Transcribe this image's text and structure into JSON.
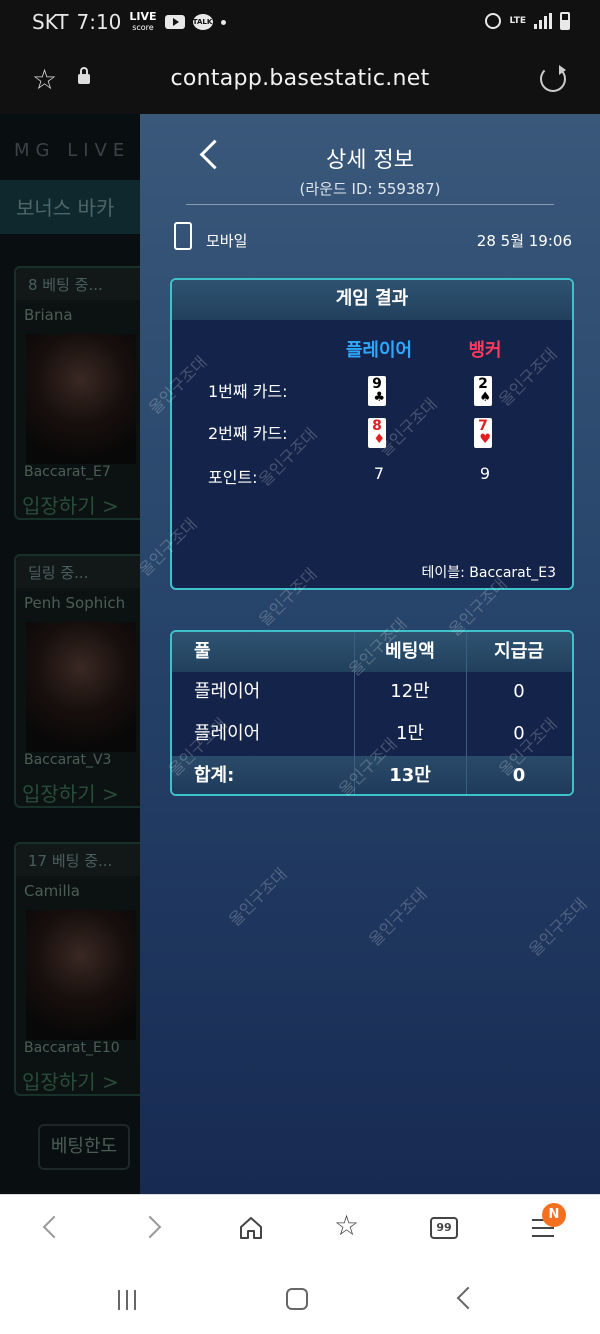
{
  "status_bar": {
    "carrier": "SKT",
    "time": "7:10",
    "live_score_badge": "LIVE score",
    "kakaotalk_badge": "TALK",
    "network": "LTE"
  },
  "url_bar": {
    "url": "contapp.basestatic.net"
  },
  "background_app": {
    "logo": "MG LIVE",
    "bonus_tab": "보너스 바카",
    "tables": [
      {
        "header": "8  베팅 중...",
        "dealer": "Briana",
        "table": "Baccarat_E7",
        "enter": "입장하기 >"
      },
      {
        "header": "딜링 중...",
        "dealer": "Penh Sophich",
        "table": "Baccarat_V3",
        "enter": "입장하기 >"
      },
      {
        "header": "17  베팅 중...",
        "dealer": "Camilla",
        "table": "Baccarat_E10",
        "enter": "입장하기 >"
      }
    ],
    "bet_limit": "베팅한도"
  },
  "detail": {
    "title": "상세 정보",
    "round_id": "(라운드 ID: 559387)",
    "device": "모바일",
    "datetime": "28  5월 19:06"
  },
  "result": {
    "heading": "게임 결과",
    "player_label": "플레이어",
    "banker_label": "뱅커",
    "rows": {
      "first_card": "1번째 카드:",
      "second_card": "2번째 카드:",
      "points": "포인트:"
    },
    "player": {
      "card1": {
        "rank": "9",
        "suit": "♣",
        "color": "black"
      },
      "card2": {
        "rank": "8",
        "suit": "♦",
        "color": "red"
      },
      "points": "7"
    },
    "banker": {
      "card1": {
        "rank": "2",
        "suit": "♠",
        "color": "black"
      },
      "card2": {
        "rank": "7",
        "suit": "♥",
        "color": "red"
      },
      "points": "9"
    },
    "table_name": "테이블: Baccarat_E3"
  },
  "bets": {
    "headers": {
      "pool": "풀",
      "amount": "베팅액",
      "payout": "지급금"
    },
    "rows": [
      {
        "pool": "플레이어",
        "amount": "12만",
        "payout": "0"
      },
      {
        "pool": "플레이어",
        "amount": "1만",
        "payout": "0"
      }
    ],
    "total": {
      "label": "합계:",
      "amount": "13만",
      "payout": "0"
    }
  },
  "watermark_text": "올인구조대",
  "browser_nav": {
    "tabs_count": "99",
    "menu_badge": "N"
  },
  "colors": {
    "player": "#2ea8ff",
    "banker": "#ff3a5a",
    "box_border": "#3fc1c9",
    "badge": "#f37021"
  }
}
